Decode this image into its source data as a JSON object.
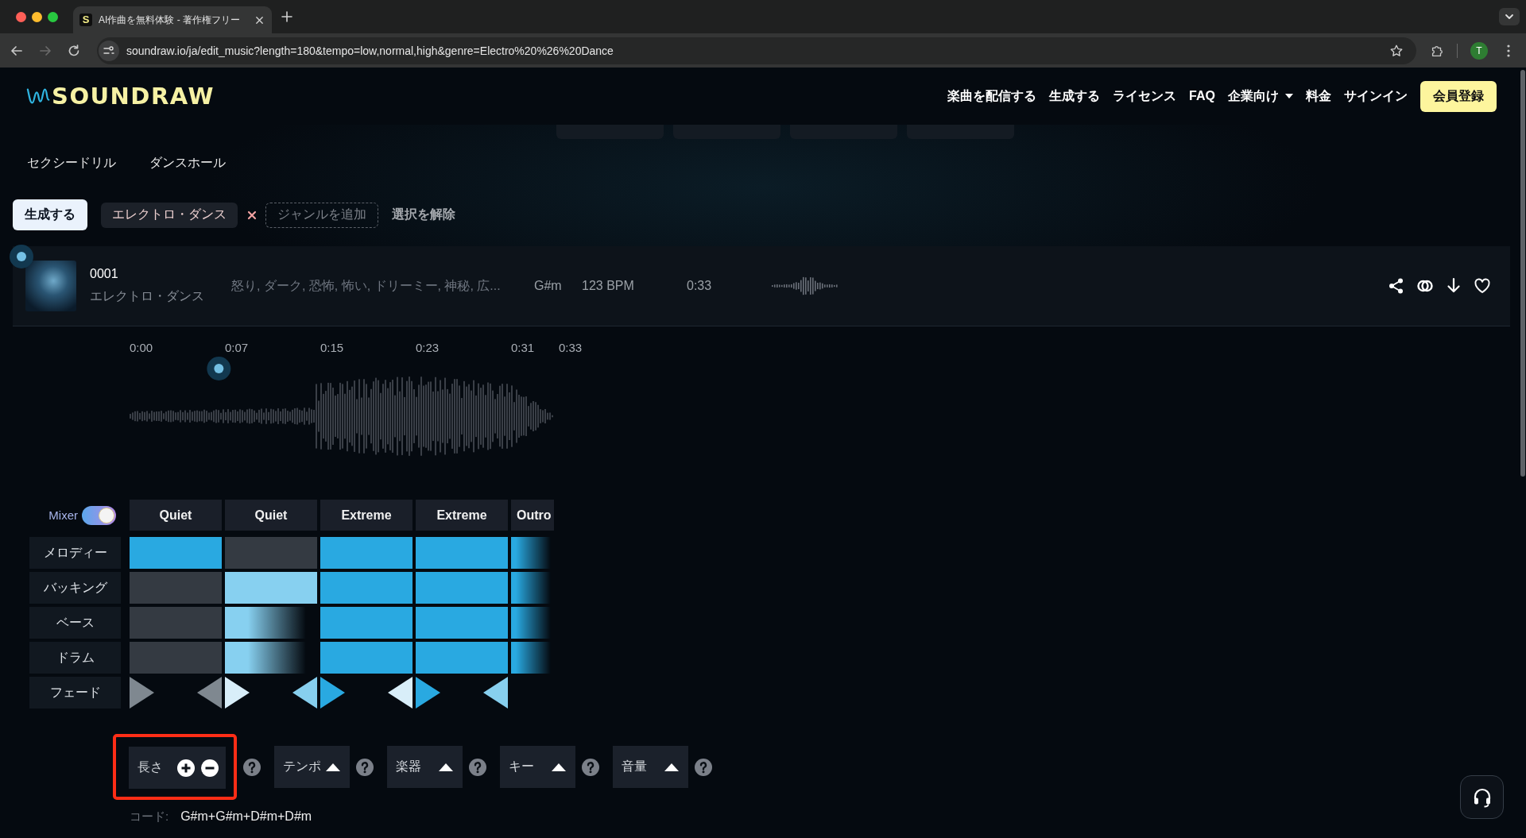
{
  "browser": {
    "tab": {
      "favicon": "S",
      "title": "AI作曲を無料体験 - 著作権フリー"
    },
    "url": "soundraw.io/ja/edit_music?length=180&tempo=low,normal,high&genre=Electro%20%26%20Dance",
    "profile_initial": "T"
  },
  "header": {
    "logo": "SOUNDRAW",
    "nav": [
      {
        "label": "楽曲を配信する",
        "kind": "link"
      },
      {
        "label": "生成する",
        "kind": "link"
      },
      {
        "label": "ライセンス",
        "kind": "link"
      },
      {
        "label": "FAQ",
        "kind": "link"
      },
      {
        "label": "企業向け",
        "kind": "dropdown"
      },
      {
        "label": "料金",
        "kind": "link"
      },
      {
        "label": "サインイン",
        "kind": "link"
      },
      {
        "label": "会員登録",
        "kind": "cta"
      }
    ]
  },
  "genres": {
    "hidden_row": [
      {
        "kind": "chip"
      },
      {
        "kind": "chip"
      },
      {
        "kind": "chip"
      },
      {
        "kind": "chip"
      }
    ],
    "options": [
      {
        "label": "セクシードリル"
      },
      {
        "label": "ダンスホール"
      }
    ]
  },
  "selection": {
    "generate": "生成する",
    "selected": [
      {
        "label": "エレクトロ・ダンス"
      }
    ],
    "add_genre": "ジャンルを追加",
    "clear": "選択を解除"
  },
  "track": {
    "number": "0001",
    "genre": "エレクトロ・ダンス",
    "moods": "怒り, ダーク, 恐怖, 怖い, ドリーミー, 神秘, 広...",
    "key": "G#m",
    "tempo": "123 BPM",
    "duration": "0:33"
  },
  "timeline": {
    "marks": [
      "0:00",
      "0:07",
      "0:15",
      "0:23",
      "0:31",
      "0:33"
    ],
    "playhead": {
      "level": 0.21
    }
  },
  "mixer": {
    "label": "Mixer",
    "on": true,
    "fade_label": "フェード",
    "sections": [
      {
        "label": "Quiet",
        "fades": [
          {
            "kind": "in",
            "color": "#7f8890"
          },
          {
            "kind": "out",
            "color": "#7f8890"
          }
        ]
      },
      {
        "label": "Quiet",
        "fades": [
          {
            "kind": "in",
            "color": "#d8eef9"
          },
          {
            "kind": "out",
            "color": "#87cfee"
          }
        ]
      },
      {
        "label": "Extreme",
        "fades": [
          {
            "kind": "in",
            "color": "#29a9e1"
          },
          {
            "kind": "out",
            "color": "#d8eef9"
          }
        ]
      },
      {
        "label": "Extreme",
        "fades": [
          {
            "kind": "in",
            "color": "#29a9e1"
          },
          {
            "kind": "out",
            "color": "#87cfee"
          }
        ]
      },
      {
        "label": "Outro"
      }
    ],
    "tracks": [
      {
        "label": "メロディー",
        "cells": [
          {
            "color": "#29a9e1",
            "fading": false
          },
          {
            "color": "#343a42",
            "fading": false
          },
          {
            "color": "#29a9e1",
            "fading": false
          },
          {
            "color": "#29a9e1",
            "fading": false
          },
          {
            "color": "#29a9e1"
          }
        ]
      },
      {
        "label": "バッキング",
        "cells": [
          {
            "color": "#343a42",
            "fading": false
          },
          {
            "color": "#87d0f0",
            "fading": false
          },
          {
            "color": "#29a9e1",
            "fading": false
          },
          {
            "color": "#29a9e1",
            "fading": false
          },
          {
            "color": "#29a9e1"
          }
        ]
      },
      {
        "label": "ベース",
        "cells": [
          {
            "color": "#343a42",
            "fading": false
          },
          {
            "color": "#87d0f0",
            "fading": true
          },
          {
            "color": "#29a9e1",
            "fading": false
          },
          {
            "color": "#29a9e1",
            "fading": false
          },
          {
            "color": "#29a9e1"
          }
        ]
      },
      {
        "label": "ドラム",
        "cells": [
          {
            "color": "#343a42",
            "fading": false
          },
          {
            "color": "#87d0f0",
            "fading": true
          },
          {
            "color": "#29a9e1",
            "fading": false
          },
          {
            "color": "#29a9e1",
            "fading": false
          },
          {
            "color": "#29a9e1"
          }
        ]
      }
    ]
  },
  "controls": [
    {
      "label": "長さ",
      "kind": "stepper",
      "highlighted": true
    },
    {
      "label": "テンポ",
      "kind": "expand",
      "highlighted": false
    },
    {
      "label": "楽器",
      "kind": "expand",
      "highlighted": false
    },
    {
      "label": "キー",
      "kind": "expand",
      "highlighted": false
    },
    {
      "label": "音量",
      "kind": "expand",
      "highlighted": false
    }
  ],
  "chord": {
    "label": "コード:",
    "value": "G#m+G#m+D#m+D#m"
  }
}
